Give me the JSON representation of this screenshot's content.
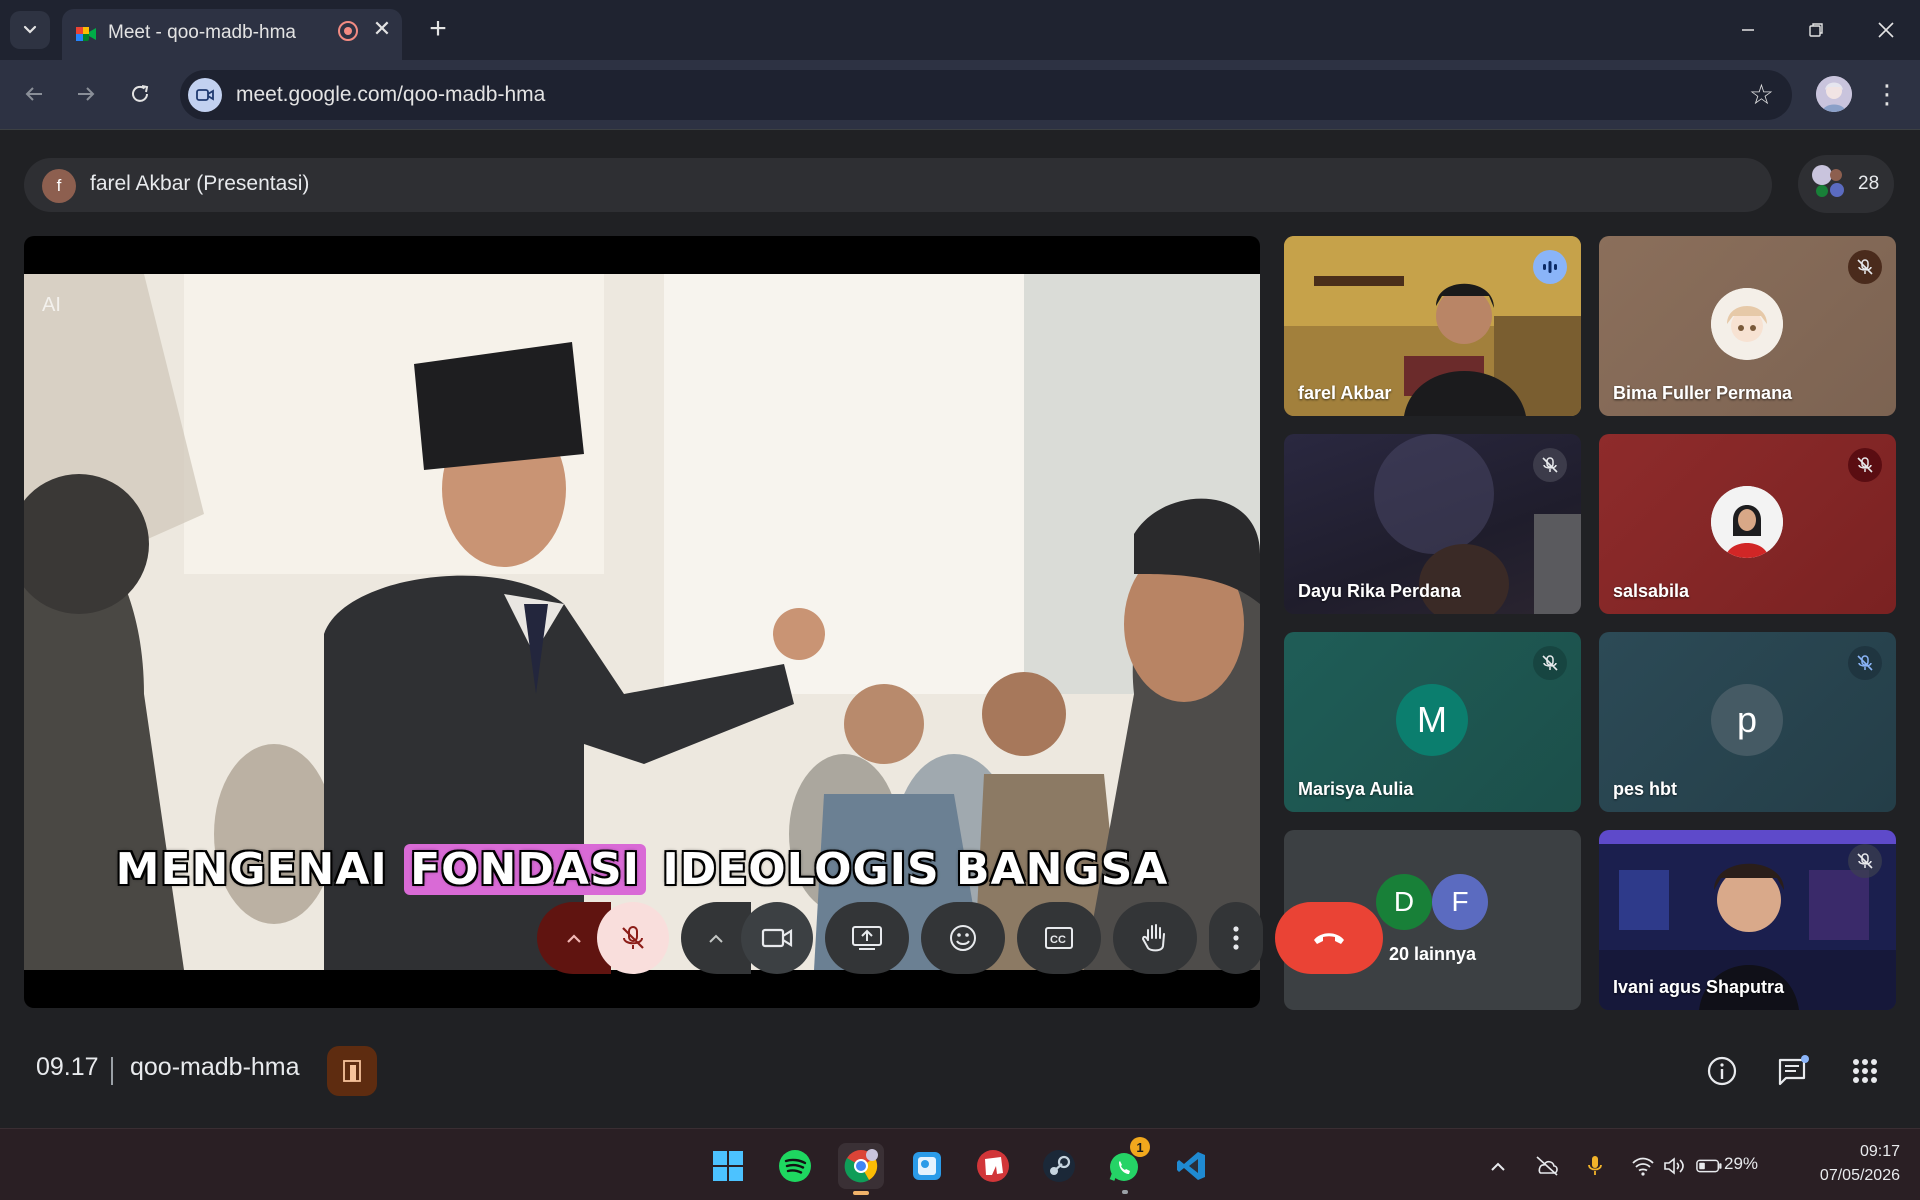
{
  "browser": {
    "tab_title": "Meet - qoo-madb-hma",
    "url": "meet.google.com/qoo-madb-hma"
  },
  "meet": {
    "presenting_label": "farel Akbar (Presentasi)",
    "presenter_initial": "f",
    "participant_count": "28",
    "slide_watermark": "AI",
    "slide_caption_before": "MENGENAI",
    "slide_caption_highlight": "FONDASI",
    "slide_caption_after": "IDEOLOGIS BANGSA",
    "tiles": [
      {
        "name": "farel Akbar",
        "state": "speaking"
      },
      {
        "name": "Bima Fuller Permana",
        "state": "muted"
      },
      {
        "name": "Dayu Rika Perdana",
        "state": "muted"
      },
      {
        "name": "salsabila",
        "state": "muted"
      },
      {
        "name": "Marisya Aulia",
        "initial": "M",
        "state": "muted"
      },
      {
        "name": "pes hbt",
        "initial": "p",
        "state": "muted"
      },
      {
        "name": "20 lainnya",
        "initials": [
          "D",
          "F"
        ]
      },
      {
        "name": "Ivani agus Shaputra",
        "state": "muted"
      }
    ],
    "clock": "09.17",
    "meeting_code": "qoo-madb-hma"
  },
  "taskbar": {
    "whatsapp_badge": "1",
    "battery": "29%",
    "time": "09:17",
    "date": "07/05/2026"
  },
  "colors": {
    "accent_blue": "#8ab4f8",
    "end_call_red": "#ea4335",
    "mute_bg": "#f9dedc",
    "mute_left": "#601410",
    "tile_gray": "#3c4043"
  }
}
